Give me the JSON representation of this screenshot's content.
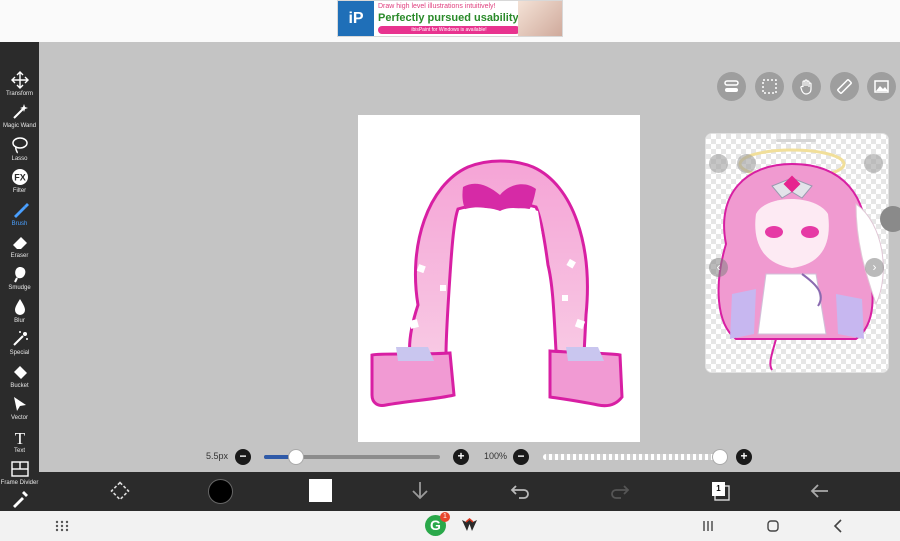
{
  "ad": {
    "logo_text": "iP",
    "line1": "Draw high level illustrations intuitively!",
    "line2": "Perfectly pursued usability!",
    "line3": "ibisPaint for Windows is available!"
  },
  "tools": [
    {
      "label": "Transform",
      "icon": "move-icon"
    },
    {
      "label": "Magic Wand",
      "icon": "magic-wand-icon"
    },
    {
      "label": "Lasso",
      "icon": "lasso-icon"
    },
    {
      "label": "Filter",
      "icon": "fx-icon"
    },
    {
      "label": "Brush",
      "icon": "brush-icon",
      "active": true
    },
    {
      "label": "Eraser",
      "icon": "eraser-icon"
    },
    {
      "label": "Smudge",
      "icon": "smudge-icon"
    },
    {
      "label": "Blur",
      "icon": "blur-drop-icon"
    },
    {
      "label": "Special",
      "icon": "special-icon"
    },
    {
      "label": "Bucket",
      "icon": "bucket-icon"
    },
    {
      "label": "Vector",
      "icon": "vector-arrow-icon"
    },
    {
      "label": "Text",
      "icon": "text-icon"
    },
    {
      "label": "Frame Divider",
      "icon": "frame-divider-icon"
    },
    {
      "label": "",
      "icon": "eyedropper-icon"
    }
  ],
  "fx_glyph": "FX",
  "text_glyph": "T",
  "brush_size": {
    "label": "5.5px",
    "level": 0.18
  },
  "opacity": {
    "label": "100%",
    "level": 1.0
  },
  "minus": "−",
  "plus": "+",
  "layer_count": "1",
  "ref_prev": "‹",
  "ref_next": "›",
  "colors": {
    "accent_blue": "#4aa0ff",
    "hair_fill": "#f3b8d9",
    "hair_outline": "#d81fa3",
    "toolbar_bg": "#2b2b2b",
    "workspace_bg": "#c4c4c4"
  },
  "nav": {
    "app_badge": "1",
    "app_g_letter": "G"
  }
}
